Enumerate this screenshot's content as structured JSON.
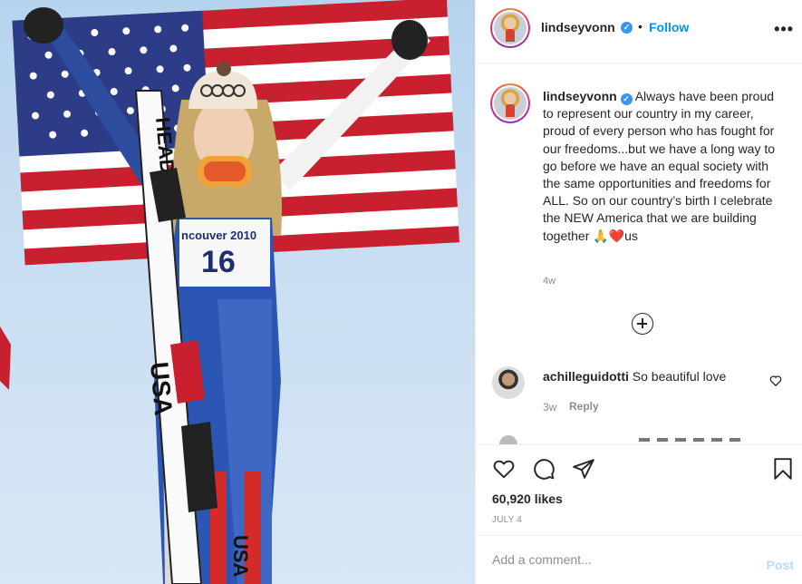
{
  "post": {
    "username": "lindseyvonn",
    "follow_label": "Follow",
    "separator": "•",
    "verified_glyph": "✓",
    "more_glyph": "•••",
    "caption": "Always have been proud to represent our country in my career, proud of every person who has fought for our freedoms...but we have a long way to go before we have an equal society with the same opportunities and freedoms for ALL. So on our country’s birth I celebrate the NEW America that we are building together 🙏❤️us",
    "caption_time": "4w",
    "likes": "60,920 likes",
    "date": "JULY 4"
  },
  "photo": {
    "bib_text": "ncouver 2010",
    "bib_number": "16",
    "suit_text": "USA",
    "ski_text": "HEAD"
  },
  "comments": [
    {
      "username": "achilleguidotti",
      "text": "So beautiful love",
      "time": "3w",
      "reply_label": "Reply"
    }
  ],
  "add_comment": {
    "placeholder": "Add a comment...",
    "post_label": "Post"
  },
  "icons": {
    "more": "more-options-icon",
    "load_more": "plus-circle-icon",
    "like": "heart-icon",
    "comment": "comment-bubble-icon",
    "share": "paper-plane-icon",
    "save": "bookmark-icon"
  },
  "colors": {
    "follow": "#0095f6",
    "verified": "#3897f0",
    "post_disabled": "#b3dbff",
    "muted": "#8e8e8e"
  }
}
